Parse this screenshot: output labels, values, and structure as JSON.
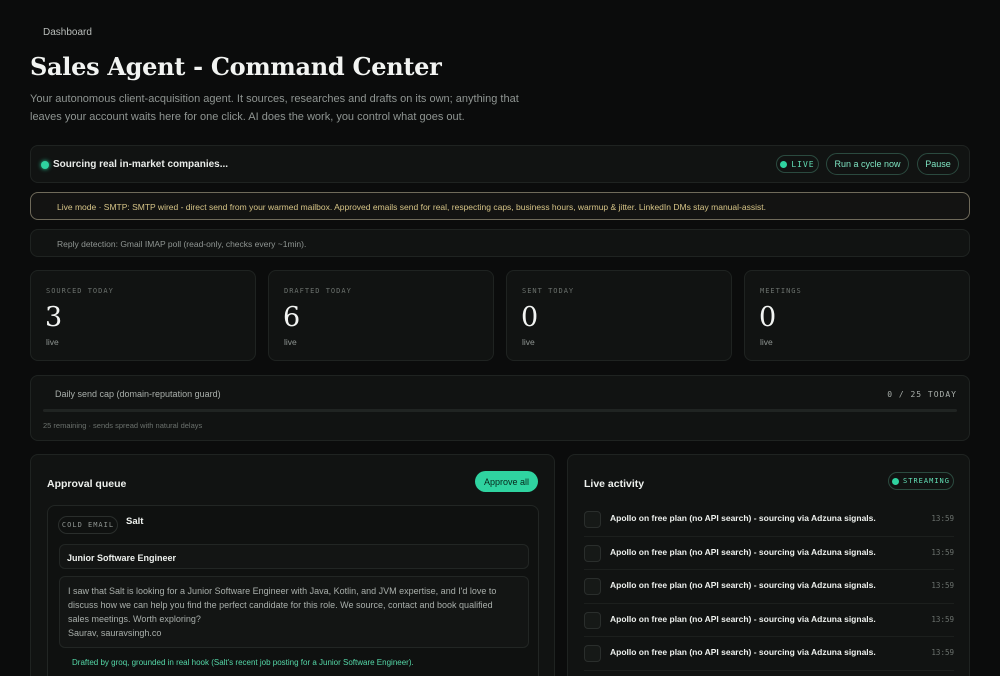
{
  "breadcrumb": "Dashboard",
  "page_title": "Sales Agent - Command Center",
  "page_description": "Your autonomous client-acquisition agent. It sources, researches and drafts on its own; anything that leaves your account waits here for one click. AI does the work, you control what goes out.",
  "status": {
    "text": "Sourcing real in-market companies...",
    "live_badge": "LIVE",
    "run_label": "Run a cycle now",
    "pause_label": "Pause"
  },
  "live_mode_notice": "Live mode · SMTP: SMTP wired - direct send from your warmed mailbox. Approved emails send for real, respecting caps, business hours, warmup & jitter. LinkedIn DMs stay manual-assist.",
  "reply_detection": "Reply detection: Gmail IMAP poll (read-only, checks every ~1min).",
  "stats": [
    {
      "label": "SOURCED TODAY",
      "value": "3",
      "sub": "live"
    },
    {
      "label": "DRAFTED TODAY",
      "value": "6",
      "sub": "live"
    },
    {
      "label": "SENT TODAY",
      "value": "0",
      "sub": "live"
    },
    {
      "label": "MEETINGS",
      "value": "0",
      "sub": "live"
    }
  ],
  "send_cap": {
    "label": "Daily send cap (domain-reputation guard)",
    "count": "0 / 25 TODAY",
    "fraction": 0,
    "note": "25 remaining · sends spread with natural delays"
  },
  "approval_queue": {
    "title": "Approval queue",
    "approve_all_label": "Approve all",
    "email": {
      "kind": "COLD EMAIL",
      "company": "Salt",
      "subject": "Junior Software Engineer",
      "body": [
        "I saw that Salt is looking for a Junior Software Engineer with Java, Kotlin, and JVM expertise, and I'd love to",
        "discuss how we can help you find the perfect candidate for this role. We source, contact and book qualified",
        "sales meetings. Worth exploring?",
        "Saurav, sauravsingh.co"
      ],
      "drafted_note": "Drafted by groq, grounded in real hook (Salt's recent job posting for a Junior Software Engineer)."
    }
  },
  "activity": {
    "title": "Live activity",
    "badge": "STREAMING",
    "items": [
      {
        "text": "Apollo on free plan (no API search) - sourcing via Adzuna signals.",
        "time": "13:59"
      },
      {
        "text": "Apollo on free plan (no API search) - sourcing via Adzuna signals.",
        "time": "13:59"
      },
      {
        "text": "Apollo on free plan (no API search) - sourcing via Adzuna signals.",
        "time": "13:59"
      },
      {
        "text": "Apollo on free plan (no API search) - sourcing via Adzuna signals.",
        "time": "13:59"
      },
      {
        "text": "Apollo on free plan (no API search) - sourcing via Adzuna signals.",
        "time": "13:59"
      }
    ]
  },
  "colors": {
    "accent": "#2fd3a0",
    "background": "#0b0c0c",
    "card": "#111312",
    "warning_text": "#d6c487"
  }
}
